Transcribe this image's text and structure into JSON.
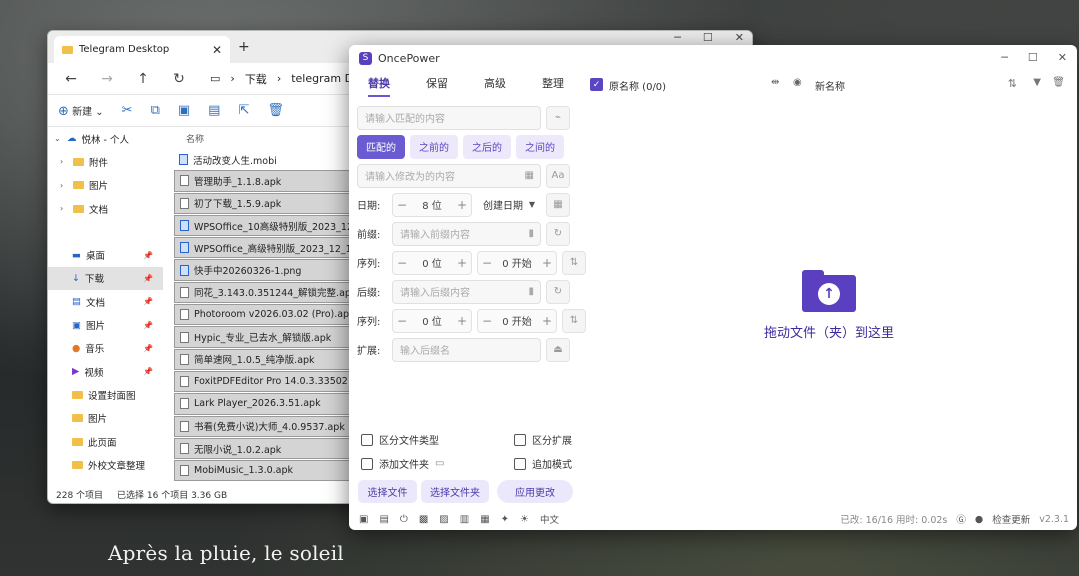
{
  "wallpaper": {
    "caption": "Après la pluie, le soleil"
  },
  "explorer": {
    "tab_title": "Telegram Desktop",
    "addr_parts": [
      "下载",
      "telegram D"
    ],
    "toolbar": {
      "new_label": "新建"
    },
    "nav": [
      {
        "label": "悦林 - 个人",
        "kind": "cloud"
      },
      {
        "label": "附件",
        "kind": "folder"
      },
      {
        "label": "图片",
        "kind": "folder"
      },
      {
        "label": "文档",
        "kind": "folder"
      },
      {
        "label": "桌面",
        "kind": "desktop"
      },
      {
        "label": "下载",
        "kind": "download"
      },
      {
        "label": "文档",
        "kind": "doc"
      },
      {
        "label": "图片",
        "kind": "pic"
      },
      {
        "label": "音乐",
        "kind": "music"
      },
      {
        "label": "视频",
        "kind": "video"
      },
      {
        "label": "设置封面图",
        "kind": "folder"
      },
      {
        "label": "图片",
        "kind": "folder"
      },
      {
        "label": "此页面",
        "kind": "folder"
      },
      {
        "label": "外校文章整理",
        "kind": "folder"
      }
    ],
    "column_name": "名称",
    "files": [
      {
        "name": "活动改变人生.mobi",
        "selected": false
      },
      {
        "name": "管理助手_1.1.8.apk",
        "selected": true
      },
      {
        "name": "初了下载_1.5.9.apk",
        "selected": true
      },
      {
        "name": "WPSOffice_10高级特别版_2023_12_1",
        "selected": true
      },
      {
        "name": "WPSOffice_高级特别版_2023_12_1",
        "selected": true
      },
      {
        "name": "快手中20260326-1.png",
        "selected": true
      },
      {
        "name": "同花_3.143.0.351244_解锁完整.apk",
        "selected": true
      },
      {
        "name": "Photoroom v2026.03.02 (Pro).apk",
        "selected": true
      },
      {
        "name": "Hypic_专业_已去水_解锁版.apk",
        "selected": true
      },
      {
        "name": "简单速网_1.0.5_纯净版.apk",
        "selected": true
      },
      {
        "name": "FoxitPDFEditor Pro 14.0.3.33502 x86",
        "selected": true
      },
      {
        "name": "Lark Player_2026.3.51.apk",
        "selected": true
      },
      {
        "name": "书看(免费小说)大师_4.0.9537.apk",
        "selected": true
      },
      {
        "name": "无限小说_1.0.2.apk",
        "selected": true
      },
      {
        "name": "MobiMusic_1.3.0.apk",
        "selected": true
      }
    ],
    "status": {
      "count": "228 个项目",
      "selected": "已选择 16 个项目 3.36 GB"
    }
  },
  "oncepower": {
    "title": "OncePower",
    "tabs": [
      "替换",
      "保留",
      "高级",
      "整理"
    ],
    "find_placeholder": "请输入匹配的内容",
    "modes": [
      "匹配的",
      "之前的",
      "之后的",
      "之间的"
    ],
    "replace_placeholder": "请输入修改为的内容",
    "date": {
      "label": "日期:",
      "value": "8 位",
      "option": "创建日期"
    },
    "prefix": {
      "label": "前缀:",
      "placeholder": "请输入前缀内容"
    },
    "seq1": {
      "label": "序列:",
      "digits": "0 位",
      "start": "0 开始"
    },
    "suffix": {
      "label": "后缀:",
      "placeholder": "请输入后缀内容"
    },
    "seq2": {
      "label": "序列:",
      "digits": "0 位",
      "start": "0 开始"
    },
    "ext": {
      "label": "扩展:",
      "placeholder": "输入后缀名"
    },
    "options": {
      "distinguish_type": "区分文件类型",
      "distinguish_ext": "区分扩展",
      "add_folder": "添加文件夹",
      "append_mode": "追加模式"
    },
    "buttons": {
      "select_files": "选择文件",
      "select_folder": "选择文件夹",
      "apply": "应用更改"
    },
    "list_header": {
      "check": "✓",
      "original": "原名称 (0/0)",
      "new": "新名称"
    },
    "drop_text": "拖动文件（夹）到这里",
    "footer": {
      "lang": "中文",
      "stats": "已改: 16/16  用时: 0.02s",
      "check_update": "检查更新",
      "version": "v2.3.1"
    }
  }
}
